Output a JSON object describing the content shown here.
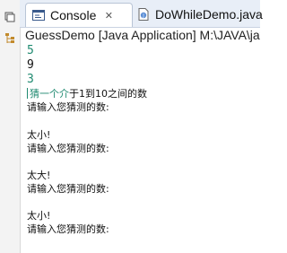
{
  "tabs": {
    "console_label": "Console",
    "dowhile_label": "DoWhileDemo.java",
    "close_glyph": "✕"
  },
  "header": {
    "text": "GuessDemo [Java Application] M:\\JAVA\\java\\"
  },
  "console": {
    "line1": "5",
    "line2": "9",
    "line3": "3",
    "hint_prefix": "猜一个介",
    "hint_rest": "于1到10之间的数",
    "prompt1": "请输入您猜测的数:",
    "result1": "太小!",
    "prompt2": "请输入您猜测的数:",
    "result2": "太大!",
    "prompt3": "请输入您猜测的数:",
    "result3": "太小!",
    "prompt4": "请输入您猜测的数:"
  },
  "colors": {
    "green_text": "#1f8a70",
    "tab_bg": "#e8eef7"
  }
}
